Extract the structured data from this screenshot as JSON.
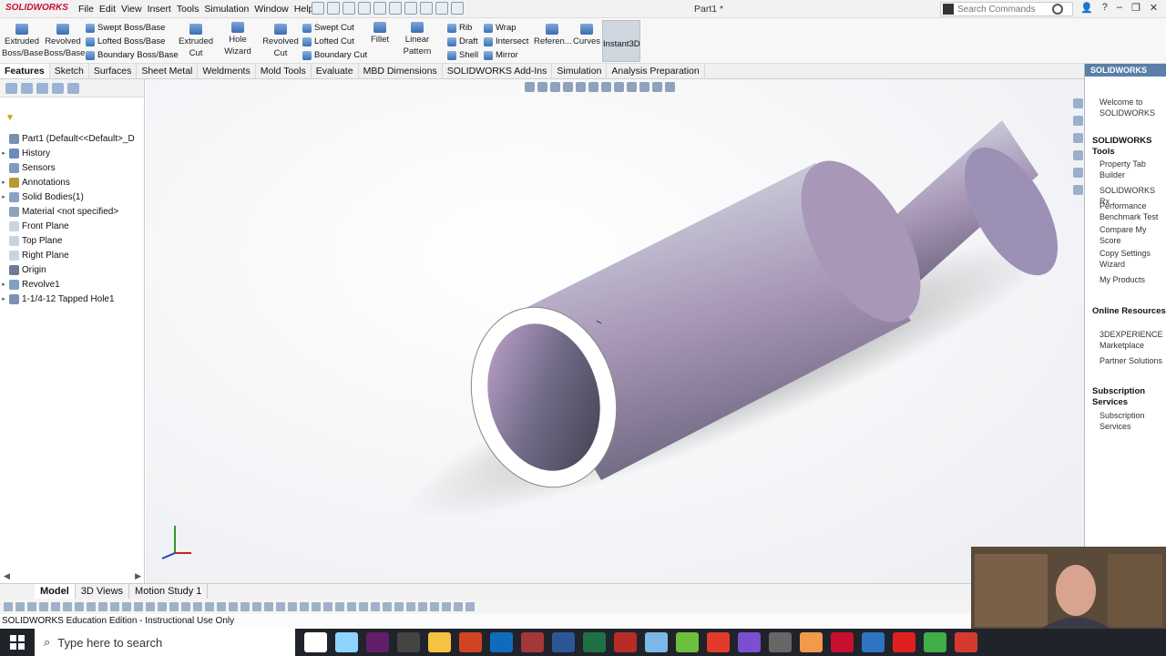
{
  "app": {
    "logo": "SOLIDWORKS",
    "document_title": "Part1 *",
    "menu": [
      "File",
      "Edit",
      "View",
      "Insert",
      "Tools",
      "Simulation",
      "Window",
      "Help"
    ],
    "search_placeholder": "Search Commands"
  },
  "ribbon": {
    "extruded_boss": "Extruded Boss/Base",
    "revolved_boss": "Revolved Boss/Base",
    "swept_boss": "Swept Boss/Base",
    "lofted_boss": "Lofted Boss/Base",
    "boundary_boss": "Boundary Boss/Base",
    "extruded_cut": "Extruded Cut",
    "hole_wizard": "Hole Wizard",
    "revolved_cut": "Revolved Cut",
    "swept_cut": "Swept Cut",
    "lofted_cut": "Lofted Cut",
    "boundary_cut": "Boundary Cut",
    "fillet": "Fillet",
    "linear_pattern": "Linear Pattern",
    "rib": "Rib",
    "draft": "Draft",
    "shell": "Shell",
    "wrap": "Wrap",
    "intersect": "Intersect",
    "mirror": "Mirror",
    "reference": "Referen...",
    "curves": "Curves",
    "instant3d": "Instant3D"
  },
  "command_tabs": [
    "Features",
    "Sketch",
    "Surfaces",
    "Sheet Metal",
    "Weldments",
    "Mold Tools",
    "Evaluate",
    "MBD Dimensions",
    "SOLIDWORKS Add-Ins",
    "Simulation",
    "Analysis Preparation"
  ],
  "tree": [
    {
      "label": "Part1  (Default<<Default>_D",
      "color": "#7a8fb0",
      "exp": ""
    },
    {
      "label": "History",
      "color": "#6c8bbd",
      "exp": "▸"
    },
    {
      "label": "Sensors",
      "color": "#7d9cc4",
      "exp": ""
    },
    {
      "label": "Annotations",
      "color": "#b89b2e",
      "exp": "▸"
    },
    {
      "label": "Solid Bodies(1)",
      "color": "#8aa0c4",
      "exp": "▸"
    },
    {
      "label": "Material <not specified>",
      "color": "#8fa3b8",
      "exp": ""
    },
    {
      "label": "Front Plane",
      "color": "#c9d4e2",
      "exp": ""
    },
    {
      "label": "Top Plane",
      "color": "#c9d4e2",
      "exp": ""
    },
    {
      "label": "Right Plane",
      "color": "#c9d4e2",
      "exp": ""
    },
    {
      "label": "Origin",
      "color": "#6b7d96",
      "exp": ""
    },
    {
      "label": "Revolve1",
      "color": "#7fa1c9",
      "exp": "▸"
    },
    {
      "label": "1-1/4-12 Tapped Hole1",
      "color": "#7b92b6",
      "exp": "▸"
    }
  ],
  "bottom_tabs": [
    "Model",
    "3D Views",
    "Motion Study 1"
  ],
  "status": "SOLIDWORKS Education Edition - Instructional Use Only",
  "taskpane": {
    "header": "SOLIDWORKS",
    "welcome": "Welcome to SOLIDWORKS",
    "tools_title": "SOLIDWORKS Tools",
    "tools": [
      "Property Tab Builder",
      "SOLIDWORKS Rx",
      "Performance Benchmark Test",
      "Compare My Score",
      "Copy Settings Wizard",
      "My Products"
    ],
    "online_title": "Online Resources",
    "online": [
      "3DEXPERIENCE Marketplace",
      "Partner Solutions"
    ],
    "sub_title": "Subscription Services",
    "sub": [
      "Subscription Services"
    ]
  },
  "taskbar": {
    "search_placeholder": "Type here to search"
  }
}
